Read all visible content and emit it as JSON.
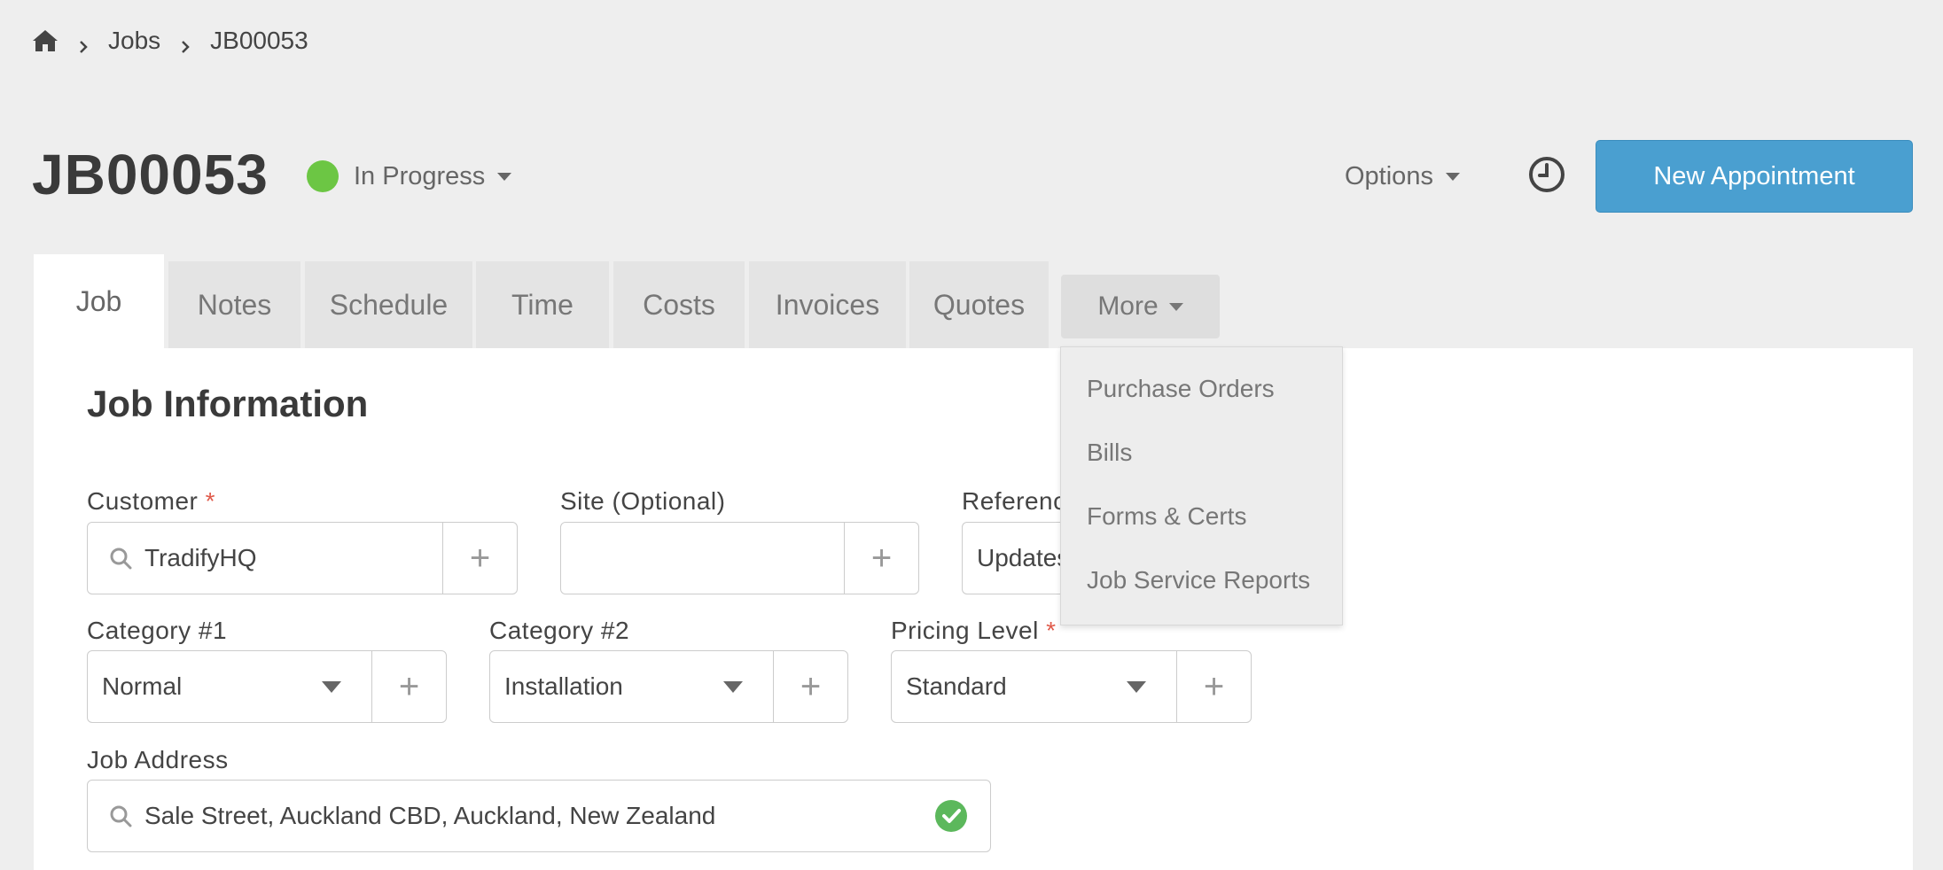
{
  "breadcrumb": {
    "items": [
      "Jobs",
      "JB00053"
    ]
  },
  "header": {
    "title": "JB00053",
    "status": "In Progress",
    "status_color": "#6cc644",
    "options_label": "Options",
    "history_icon": "clock-icon",
    "new_appointment_label": "New Appointment",
    "accent_color": "#4a9fd0"
  },
  "tabs": [
    "Job",
    "Notes",
    "Schedule",
    "Time",
    "Costs",
    "Invoices",
    "Quotes"
  ],
  "more_tab": {
    "label": "More",
    "menu_items": [
      "Purchase Orders",
      "Bills",
      "Forms & Certs",
      "Job Service Reports"
    ]
  },
  "job_info": {
    "title": "Job Information",
    "customer": {
      "label": "Customer",
      "required_mark": "*",
      "value": "TradifyHQ"
    },
    "site": {
      "label": "Site (Optional)",
      "value": ""
    },
    "reference": {
      "label": "Referenc",
      "value": "Updates"
    },
    "category1": {
      "label": "Category #1",
      "value": "Normal"
    },
    "category2": {
      "label": "Category #2",
      "value": "Installation"
    },
    "pricing_level": {
      "label": "Pricing Level",
      "required_mark": "*",
      "value": "Standard"
    },
    "job_address": {
      "label": "Job Address",
      "value": "Sale Street, Auckland CBD, Auckland, New Zealand"
    }
  }
}
